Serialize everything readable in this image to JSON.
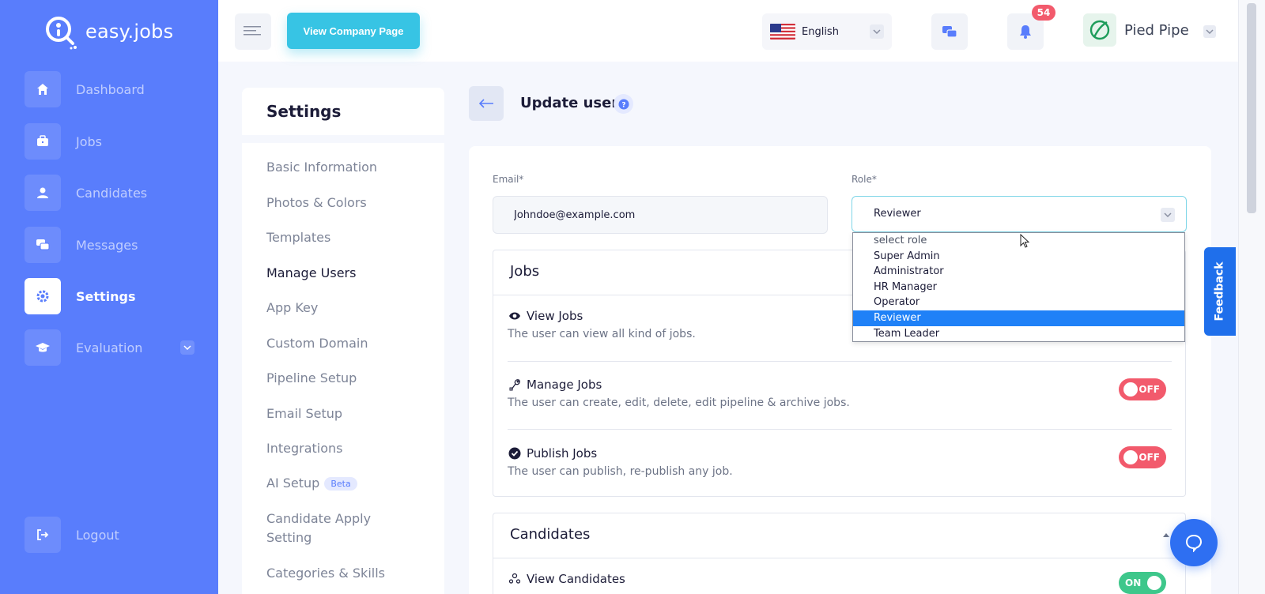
{
  "brand": {
    "name": "easy.jobs"
  },
  "sidebar": {
    "items": [
      {
        "label": "Dashboard",
        "icon": "home-icon"
      },
      {
        "label": "Jobs",
        "icon": "briefcase-icon"
      },
      {
        "label": "Candidates",
        "icon": "user-icon"
      },
      {
        "label": "Messages",
        "icon": "chat-icon"
      },
      {
        "label": "Settings",
        "icon": "gear-icon",
        "active": true
      },
      {
        "label": "Evaluation",
        "icon": "graduation-cap-icon"
      }
    ],
    "logout": "Logout"
  },
  "header": {
    "company_page_button": "View Company Page",
    "language": "English",
    "notification_count": "54",
    "company_name": "Pied Pipe"
  },
  "settings_menu": {
    "title": "Settings",
    "items": [
      "Basic Information",
      "Photos & Colors",
      "Templates",
      "Manage Users",
      "App Key",
      "Custom Domain",
      "Pipeline Setup",
      "Email Setup",
      "Integrations",
      "AI Setup",
      "Candidate Apply",
      "Setting",
      "Categories & Skills"
    ],
    "beta_label": "Beta",
    "active": "Manage Users"
  },
  "page": {
    "title": "Update user"
  },
  "form": {
    "email_label": "Email*",
    "email_value": "Johndoe@example.com",
    "role_label": "Role*",
    "role_value": "Reviewer",
    "role_options": [
      "select role",
      "Super Admin",
      "Administrator",
      "HR Manager",
      "Operator",
      "Reviewer",
      "Team Leader"
    ]
  },
  "sections": {
    "jobs": {
      "title": "Jobs",
      "permissions": [
        {
          "title": "View Jobs",
          "desc": "The user can view all kind of jobs."
        },
        {
          "title": "Manage Jobs",
          "desc": "The user can create, edit, delete, edit pipeline & archive jobs.",
          "toggle": "OFF"
        },
        {
          "title": "Publish Jobs",
          "desc": "The user can publish, re-publish any job.",
          "toggle": "OFF"
        }
      ]
    },
    "candidates": {
      "title": "Candidates",
      "permissions": [
        {
          "title": "View Candidates",
          "toggle": "ON"
        }
      ]
    }
  },
  "feedback_label": "Feedback",
  "colors": {
    "sidebar": "#597dfc",
    "accent_cyan": "#37c4e4",
    "toggle_off": "#f25a6c",
    "toggle_on": "#3ec78b",
    "selected_option": "#1f81f7"
  }
}
